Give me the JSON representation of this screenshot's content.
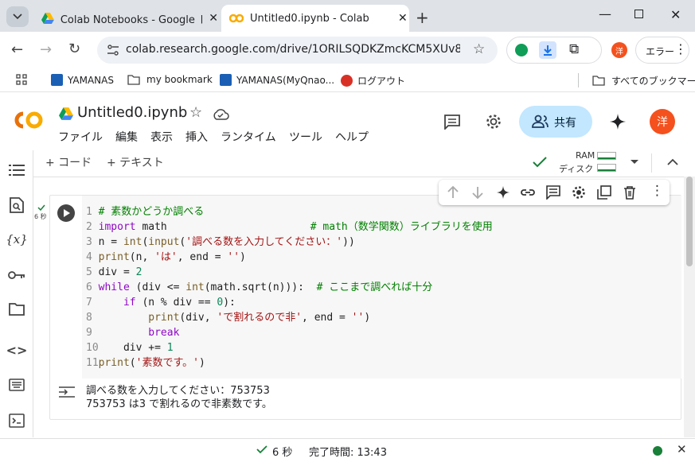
{
  "browser": {
    "tabs": [
      {
        "title": "Colab Notebooks - Google ドライブ",
        "active": false
      },
      {
        "title": "Untitled0.ipynb - Colab",
        "active": true
      }
    ],
    "url": "colab.research.google.com/drive/1ORILSQDKZmcKCM5XUv8qryKZ...",
    "error_label": "エラー",
    "avatar_char": "洋",
    "bookmarks": [
      "YAMANAS",
      "my bookmark",
      "YAMANAS(MyQnao...",
      "ログアウト"
    ],
    "all_bookmarks": "すべてのブックマーク"
  },
  "colab": {
    "notebook_title": "Untitled0.ipynb",
    "menu": [
      "ファイル",
      "編集",
      "表示",
      "挿入",
      "ランタイム",
      "ツール",
      "ヘルプ"
    ],
    "share_label": "共有",
    "avatar_char": "洋",
    "add_code": "+ コード",
    "add_text": "+ テキスト",
    "ram_label": "RAM",
    "disk_label": "ディスク"
  },
  "cell": {
    "exec_time": "6 秒",
    "lines": [
      "1",
      "2",
      "3",
      "4",
      "5",
      "6",
      "7",
      "8",
      "9",
      "10",
      "11"
    ],
    "code_text": [
      "# 素数かどうか調べる",
      "import math                       # math（数学関数）ライブラリを使用",
      "n = int(input('調べる数を入力してください：'))",
      "print(n, 'は', end = '')",
      "div = 2",
      "while (div <= int(math.sqrt(n))):  # ここまで調べれば十分",
      "    if (n % div == 0):",
      "        print(div, 'で割れるので非', end = '')",
      "        break",
      "    div += 1",
      "print('素数です。')"
    ],
    "output_lines": [
      "調べる数を入力してください：753753",
      "753753 は3 で割れるので非素数です。"
    ]
  },
  "status": {
    "duration": "6 秒",
    "completed": "完了時間: 13:43"
  },
  "colors": {
    "accent": "#f9ab00",
    "share_bg": "#c2e7ff",
    "avatar": "#f4511e",
    "check": "#188038"
  }
}
